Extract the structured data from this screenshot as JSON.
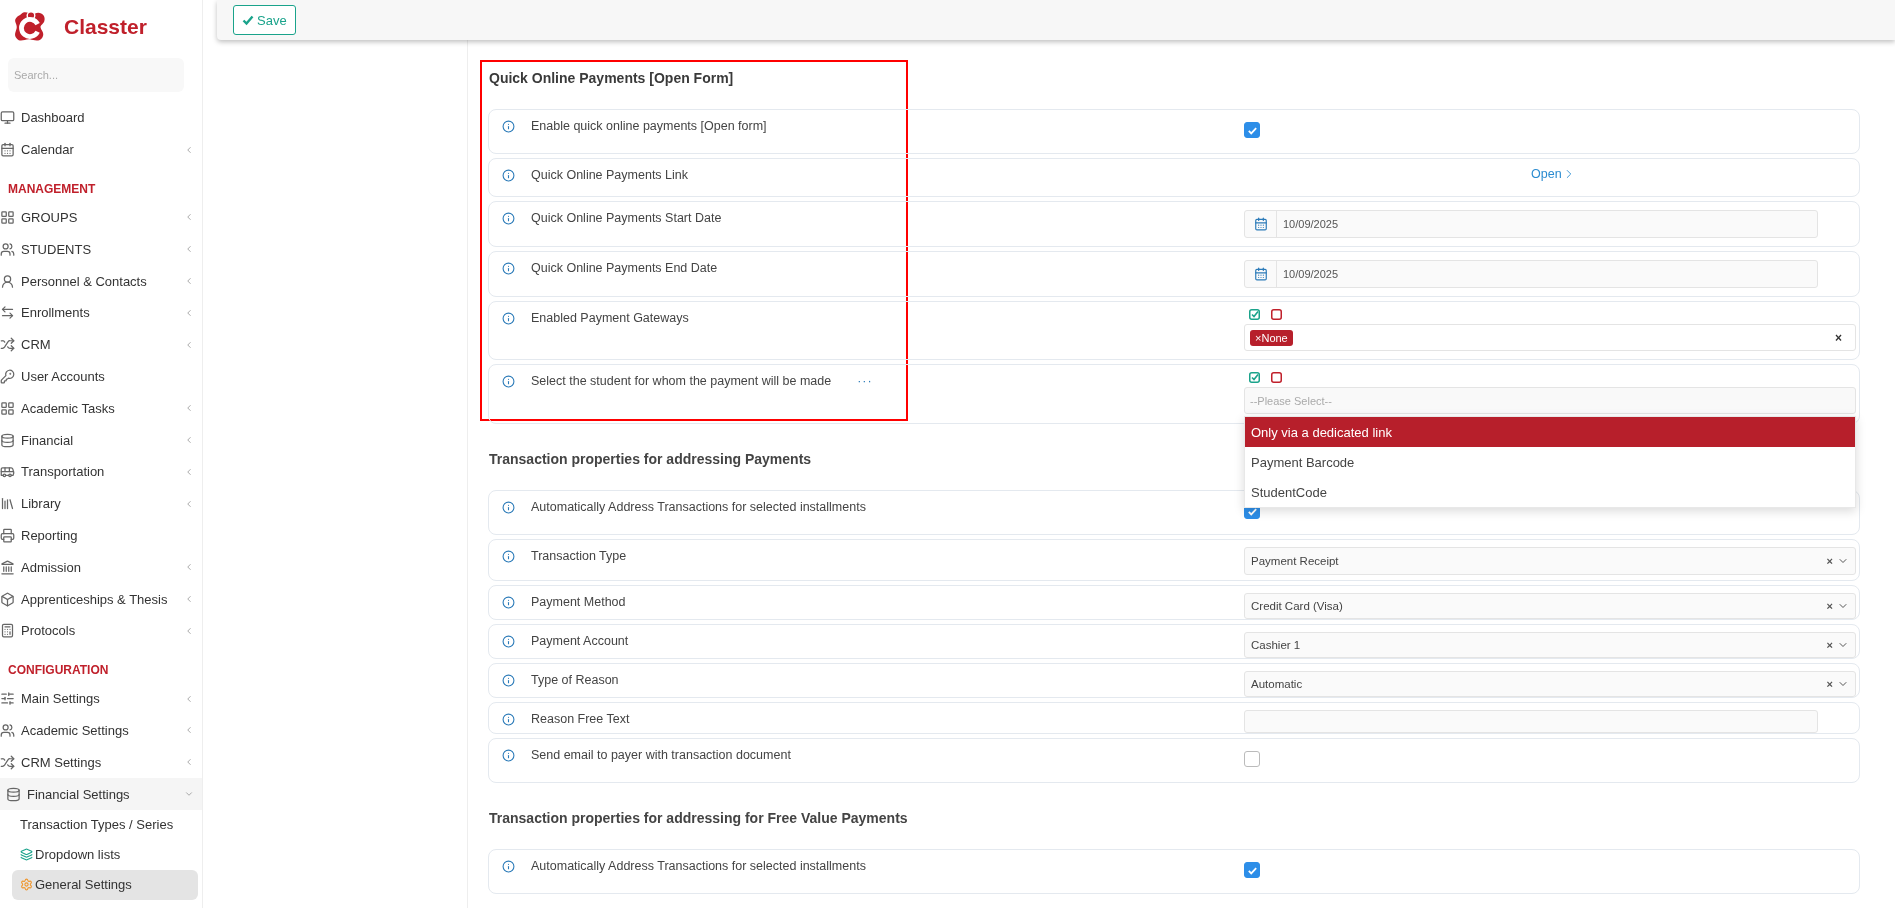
{
  "sidebar": {
    "brand": "Classter",
    "search": {
      "placeholder": "Search..."
    },
    "groups": [
      {
        "items": [
          {
            "label": "Dashboard",
            "submenu": false,
            "selected": false
          },
          {
            "label": "Calendar",
            "submenu": true,
            "selected": false
          }
        ]
      },
      {
        "heading": "MANAGEMENT",
        "items": [
          {
            "label": "GROUPS",
            "submenu": true,
            "selected": false
          },
          {
            "label": "STUDENTS",
            "submenu": true,
            "selected": false
          },
          {
            "label": "Personnel & Contacts",
            "submenu": true,
            "selected": false
          },
          {
            "label": "Enrollments",
            "submenu": true,
            "selected": false
          },
          {
            "label": "CRM",
            "submenu": true,
            "selected": false
          },
          {
            "label": "User Accounts",
            "submenu": false,
            "selected": false
          },
          {
            "label": "Academic Tasks",
            "submenu": true,
            "selected": false
          },
          {
            "label": "Financial",
            "submenu": true,
            "selected": false
          },
          {
            "label": "Transportation",
            "submenu": true,
            "selected": false
          },
          {
            "label": "Library",
            "submenu": true,
            "selected": false
          },
          {
            "label": "Reporting",
            "submenu": false,
            "selected": false
          },
          {
            "label": "Admission",
            "submenu": true,
            "selected": false
          },
          {
            "label": "Apprenticeships & Thesis",
            "submenu": true,
            "selected": false
          },
          {
            "label": "Protocols",
            "submenu": true,
            "selected": false
          }
        ]
      },
      {
        "heading": "CONFIGURATION",
        "items": [
          {
            "label": "Main Settings",
            "submenu": true,
            "selected": false
          },
          {
            "label": "Academic Settings",
            "submenu": true,
            "selected": false
          },
          {
            "label": "CRM Settings",
            "submenu": true,
            "selected": false
          },
          {
            "label": "Financial Settings",
            "submenu": true,
            "selected": false,
            "expanded": true,
            "children": [
              {
                "label": "Transaction Types / Series",
                "selected": false
              },
              {
                "label": "Dropdown lists",
                "selected": false
              },
              {
                "label": "General Settings",
                "selected": true
              }
            ]
          }
        ]
      }
    ]
  },
  "toolbar": {
    "save_button": "Save"
  },
  "sections": [
    {
      "title": "Quick Online Payments [Open Form]",
      "highlighted": true,
      "rows": [
        {
          "label": "Enable quick online payments [Open form]",
          "kind": "checkbox",
          "checked": true
        },
        {
          "label": "Quick Online Payments Link",
          "kind": "link",
          "link": "Open"
        },
        {
          "label": "Quick Online Payments Start Date",
          "kind": "date",
          "value": "10/09/2025"
        },
        {
          "label": "Quick Online Payments End Date",
          "kind": "date",
          "value": "10/09/2025"
        },
        {
          "label": "Enabled Payment Gateways",
          "kind": "multiselect",
          "tags": [
            {
              "label": "None",
              "remove": "×"
            }
          ],
          "clear": "×"
        },
        {
          "label": "Select the student for whom the payment will be made",
          "more": "···",
          "kind": "dropdown",
          "placeholder": "--Please Select--",
          "expanded": true,
          "options": [
            {
              "label": "Only via a dedicated link",
              "selected": true
            },
            {
              "label": "Payment Barcode",
              "selected": false
            },
            {
              "label": "StudentCode",
              "selected": false
            }
          ]
        }
      ]
    },
    {
      "title": "Transaction properties for addressing Payments",
      "highlighted": false,
      "rows": [
        {
          "label": "Automatically Address Transactions for selected installments",
          "kind": "checkbox",
          "checked": true
        },
        {
          "label": "Transaction Type",
          "kind": "select",
          "value": "Payment Receipt",
          "clear": "×"
        },
        {
          "label": "Payment Method",
          "kind": "select",
          "value": "Credit Card (Visa)",
          "clear": "×"
        },
        {
          "label": "Payment Account",
          "kind": "select",
          "value": "Cashier 1",
          "clear": "×"
        },
        {
          "label": "Type of Reason",
          "kind": "select",
          "value": "Automatic",
          "clear": "×"
        },
        {
          "label": "Reason Free Text",
          "kind": "text"
        },
        {
          "label": "Send email to payer with transaction document",
          "kind": "checkbox",
          "checked": false
        }
      ]
    },
    {
      "title": "Transaction properties for addressing for Free Value Payments",
      "highlighted": false,
      "rows": [
        {
          "label": "Automatically Address Transactions for selected installments",
          "kind": "checkbox",
          "checked": true
        }
      ]
    }
  ]
}
